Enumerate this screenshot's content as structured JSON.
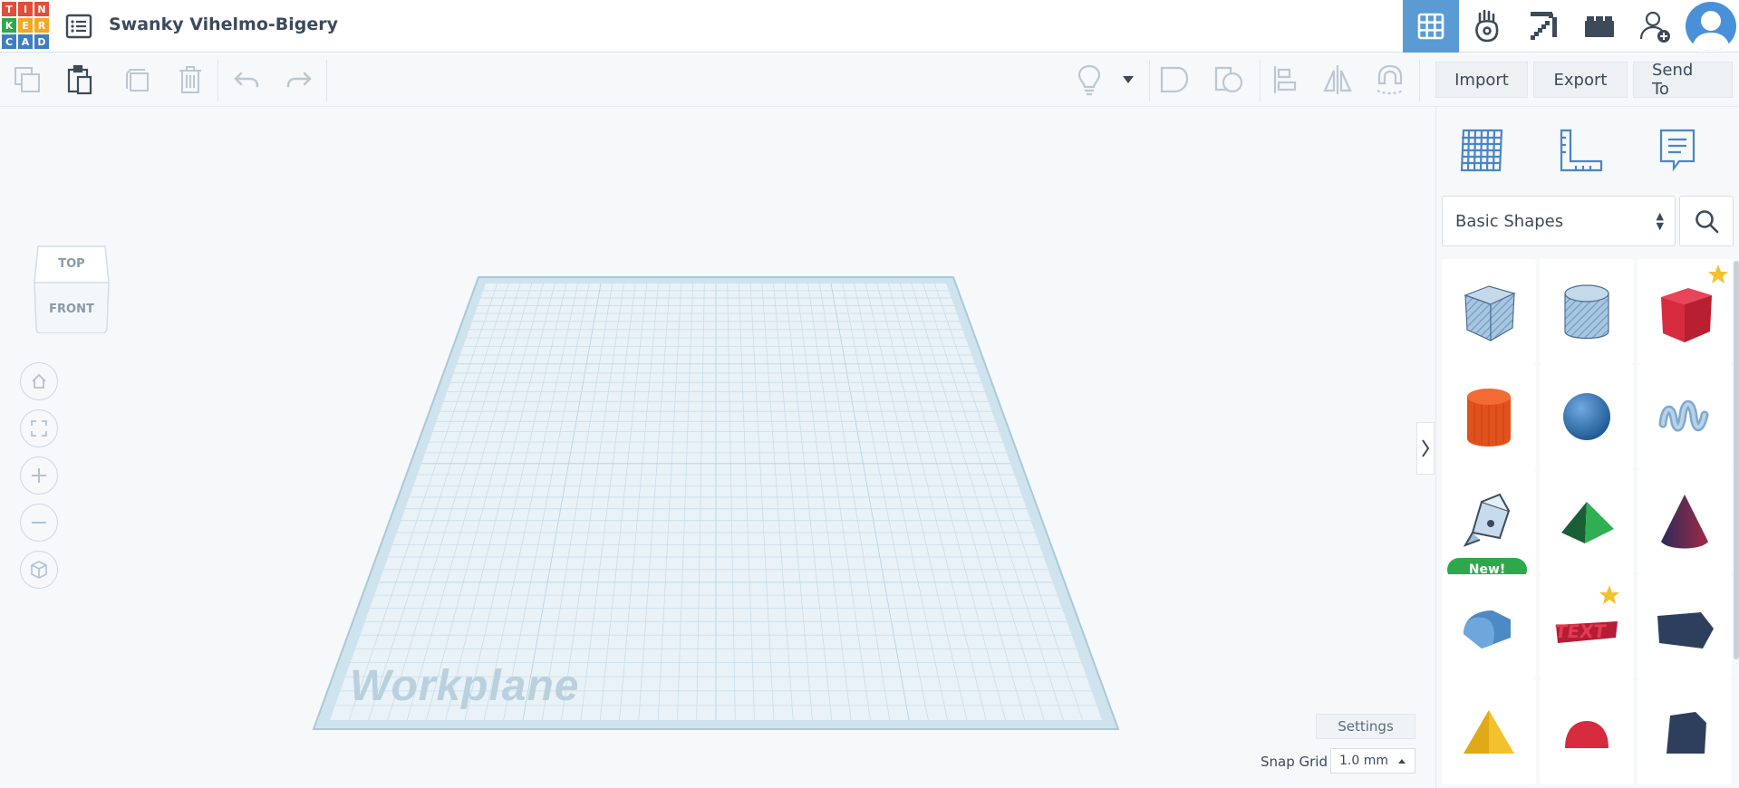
{
  "header": {
    "logo_letters": [
      "T",
      "I",
      "N",
      "K",
      "E",
      "R",
      "C",
      "A",
      "D"
    ],
    "design_title": "Swanky Vihelmo-Bigery",
    "colors": {
      "active_tab": "#5a9bd4",
      "logo_red": "#e04e39",
      "logo_orange": "#f5a623",
      "logo_green": "#2ea84b",
      "logo_blue": "#3f7dc1"
    },
    "icons": [
      "3d-design-grid-icon",
      "circuits-hand-icon",
      "minecraft-pickaxe-icon",
      "lego-brick-icon",
      "invite-user-icon",
      "user-avatar"
    ]
  },
  "toolbar": {
    "icons": [
      "copy-icon",
      "paste-icon",
      "duplicate-icon",
      "delete-icon",
      "undo-icon",
      "redo-icon",
      "lightbulb-icon",
      "dropdown-caret-icon",
      "group-icon",
      "ungroup-icon",
      "align-icon",
      "mirror-icon",
      "magnet-icon"
    ],
    "import_label": "Import",
    "export_label": "Export",
    "send_to_label": "Send To"
  },
  "viewcube": {
    "top_label": "TOP",
    "front_label": "FRONT"
  },
  "nav_buttons": [
    "home-view-icon",
    "fit-view-icon",
    "zoom-in-icon",
    "zoom-out-icon",
    "perspective-icon"
  ],
  "workplane": {
    "label": "Workplane"
  },
  "bottom_controls": {
    "settings_label": "Settings",
    "snap_grid_label": "Snap Grid",
    "snap_grid_value": "1.0 mm"
  },
  "right_panel": {
    "tabs": [
      "workplane-grid-icon",
      "ruler-icon",
      "notes-icon"
    ],
    "category_select": "Basic Shapes",
    "shapes": [
      {
        "name": "box-hole",
        "starred": false,
        "is_new": false
      },
      {
        "name": "cylinder-hole",
        "starred": false,
        "is_new": false
      },
      {
        "name": "box",
        "starred": true,
        "is_new": false
      },
      {
        "name": "cylinder",
        "starred": false,
        "is_new": false
      },
      {
        "name": "sphere",
        "starred": false,
        "is_new": false
      },
      {
        "name": "scribble",
        "starred": false,
        "is_new": false
      },
      {
        "name": "graphics",
        "starred": false,
        "is_new": true
      },
      {
        "name": "roof",
        "starred": false,
        "is_new": false
      },
      {
        "name": "cone",
        "starred": false,
        "is_new": false
      },
      {
        "name": "round-roof",
        "starred": false,
        "is_new": false
      },
      {
        "name": "text",
        "starred": true,
        "is_new": false
      },
      {
        "name": "wedge",
        "starred": false,
        "is_new": false
      },
      {
        "name": "pyramid",
        "starred": false,
        "is_new": false
      },
      {
        "name": "half-sphere",
        "starred": false,
        "is_new": false
      },
      {
        "name": "polygon",
        "starred": false,
        "is_new": false
      }
    ],
    "new_badge_label": "New!"
  }
}
